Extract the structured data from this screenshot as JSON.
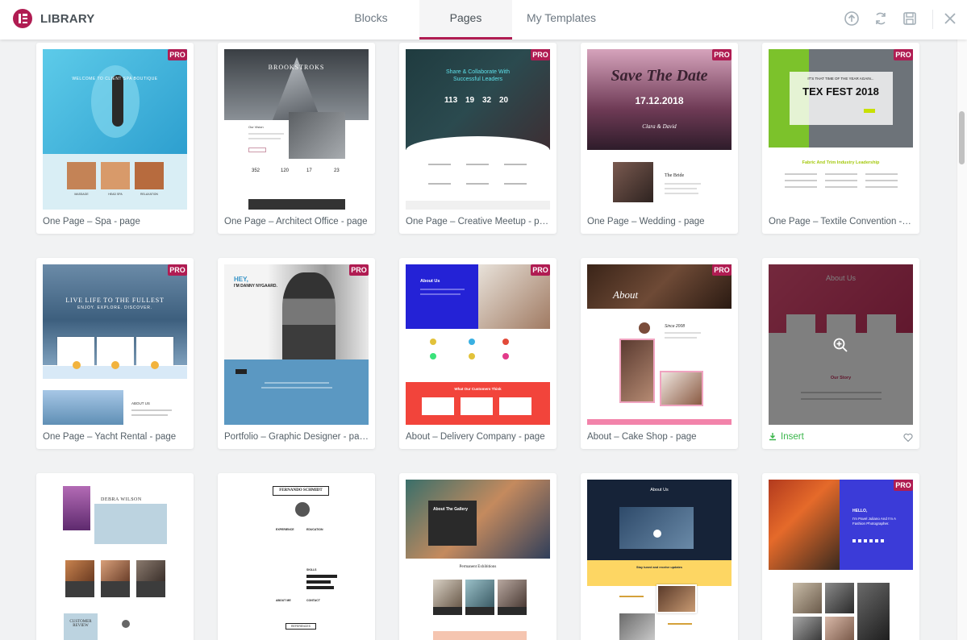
{
  "header": {
    "logo_text": "LIBRARY",
    "tabs": [
      {
        "label": "Blocks",
        "active": false
      },
      {
        "label": "Pages",
        "active": true
      },
      {
        "label": "My Templates",
        "active": false
      }
    ],
    "accent_color": "#b01c52",
    "icons": [
      "upload-icon",
      "sync-icon",
      "save-icon",
      "close-icon"
    ]
  },
  "cards": [
    {
      "title": "One Page – Spa - page",
      "pro": "PRO",
      "thumb_text": [
        "WELCOME TO CLIENT SPA BOUTIQUE",
        "MASSAGE",
        "HEAD SPA",
        "RELAXATION"
      ]
    },
    {
      "title": "One Page – Architect Office - page",
      "pro": "",
      "thumb_text": [
        "BROOKSTROKS",
        "Our Vision",
        "352",
        "120",
        "17",
        "23"
      ]
    },
    {
      "title": "One Page – Creative Meetup - page",
      "pro": "PRO",
      "thumb_text": [
        "Share & Collaborate With",
        "Successful Leaders",
        "113",
        "19",
        "32",
        "20"
      ]
    },
    {
      "title": "One Page – Wedding - page",
      "pro": "PRO",
      "thumb_text": [
        "Save The Date",
        "17.12.2018",
        "Clara & David",
        "The Bride"
      ]
    },
    {
      "title": "One Page – Textile Convention - page",
      "pro": "PRO",
      "thumb_text": [
        "IT'S THAT TIME OF THE YEAR AGAIN...",
        "TEX FEST 2018",
        "Fabric And Trim Industry Leadership"
      ]
    },
    {
      "title": "One Page – Yacht Rental - page",
      "pro": "PRO",
      "thumb_text": [
        "LIVE LIFE TO THE FULLEST",
        "ENJOY. EXPLORE. DISCOVER.",
        "ABOUT US"
      ]
    },
    {
      "title": "Portfolio – Graphic Designer - page",
      "pro": "PRO",
      "thumb_text": [
        "HEY,",
        "I'M DANNY NYGAARD."
      ]
    },
    {
      "title": "About – Delivery Company - page",
      "pro": "PRO",
      "thumb_text": [
        "About Us",
        "What Our Customers Think"
      ]
    },
    {
      "title": "About – Cake Shop - page",
      "pro": "PRO",
      "thumb_text": [
        "About",
        "Since 2008"
      ]
    },
    {
      "title": "",
      "pro": "",
      "insert_label": "Insert",
      "thumb_text": [
        "About Us",
        "Our Story"
      ]
    },
    {
      "title": "",
      "pro": "",
      "thumb_text": [
        "DEBRA WILSON",
        "CUSTOMER REVIEW"
      ]
    },
    {
      "title": "",
      "pro": "",
      "thumb_text": [
        "FERNANDO SCHMIDT",
        "EXPERIENCE",
        "EDUCATION",
        "SKILLS",
        "ABOUT ME",
        "CONTACT",
        "REFERENCES"
      ]
    },
    {
      "title": "",
      "pro": "",
      "thumb_text": [
        "About The Gallery",
        "Permanent Exhibitions"
      ]
    },
    {
      "title": "",
      "pro": "",
      "thumb_text": [
        "About Us",
        "Stay tuned and receive updates"
      ]
    },
    {
      "title": "",
      "pro": "PRO",
      "thumb_text": [
        "HELLO,",
        "I'm Pavel Juliano And I'm A Fashion Photographer."
      ]
    }
  ]
}
